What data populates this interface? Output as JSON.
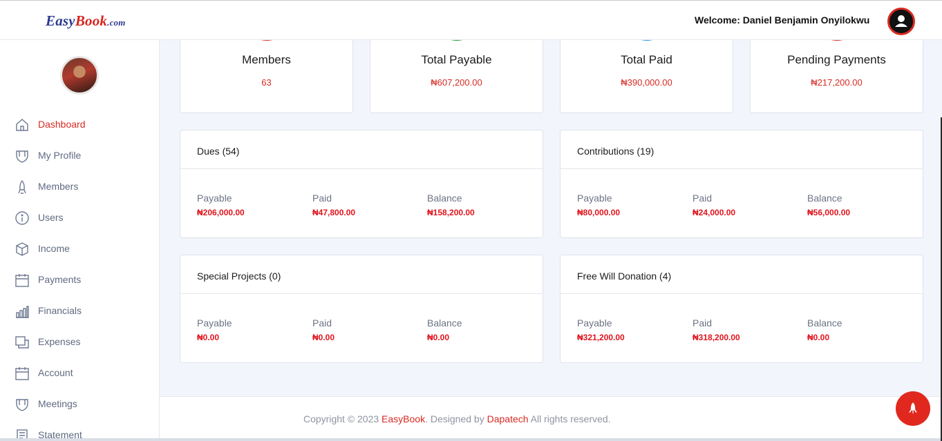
{
  "header": {
    "logo": {
      "part1": "Easy",
      "part2": "Book",
      "part3": ".com"
    },
    "welcome": "Welcome: Daniel Benjamin Onyilokwu"
  },
  "sidebar": {
    "items": [
      {
        "label": "Dashboard",
        "icon": "home-icon",
        "active": true
      },
      {
        "label": "My Profile",
        "icon": "shield-icon"
      },
      {
        "label": "Members",
        "icon": "rocket-icon"
      },
      {
        "label": "Users",
        "icon": "info-icon"
      },
      {
        "label": "Income",
        "icon": "box-icon"
      },
      {
        "label": "Payments",
        "icon": "calendar-icon"
      },
      {
        "label": "Financials",
        "icon": "bar-chart-icon"
      },
      {
        "label": "Expenses",
        "icon": "copy-icon"
      },
      {
        "label": "Account",
        "icon": "calendar-icon"
      },
      {
        "label": "Meetings",
        "icon": "shield-icon"
      },
      {
        "label": "Statement",
        "icon": "document-icon"
      }
    ]
  },
  "stats": [
    {
      "title": "Members",
      "value": "63",
      "color": "#e0352a"
    },
    {
      "title": "Total Payable",
      "value": "₦607,200.00",
      "color": "#2aa43a"
    },
    {
      "title": "Total Paid",
      "value": "₦390,000.00",
      "color": "#2d9de0"
    },
    {
      "title": "Pending Payments",
      "value": "₦217,200.00",
      "color": "#e0352a"
    }
  ],
  "panels": [
    {
      "title": "Dues (54)",
      "columns": [
        {
          "label": "Payable",
          "value": "₦206,000.00"
        },
        {
          "label": "Paid",
          "value": "₦47,800.00"
        },
        {
          "label": "Balance",
          "value": "₦158,200.00"
        }
      ]
    },
    {
      "title": "Contributions (19)",
      "columns": [
        {
          "label": "Payable",
          "value": "₦80,000.00"
        },
        {
          "label": "Paid",
          "value": "₦24,000.00"
        },
        {
          "label": "Balance",
          "value": "₦56,000.00"
        }
      ]
    },
    {
      "title": "Special Projects (0)",
      "columns": [
        {
          "label": "Payable",
          "value": "₦0.00"
        },
        {
          "label": "Paid",
          "value": "₦0.00"
        },
        {
          "label": "Balance",
          "value": "₦0.00"
        }
      ]
    },
    {
      "title": "Free Will Donation (4)",
      "columns": [
        {
          "label": "Payable",
          "value": "₦321,200.00"
        },
        {
          "label": "Paid",
          "value": "₦318,200.00"
        },
        {
          "label": "Balance",
          "value": "₦0.00"
        }
      ]
    }
  ],
  "footer": {
    "prefix": "Copyright © 2023 ",
    "brand": "EasyBook",
    "middle": ". Designed by ",
    "designer": "Dapatech",
    "suffix": " All rights reserved."
  },
  "colors": {
    "accent": "#d62a22",
    "value_red": "#e0141c",
    "background": "#f2f5fb"
  }
}
